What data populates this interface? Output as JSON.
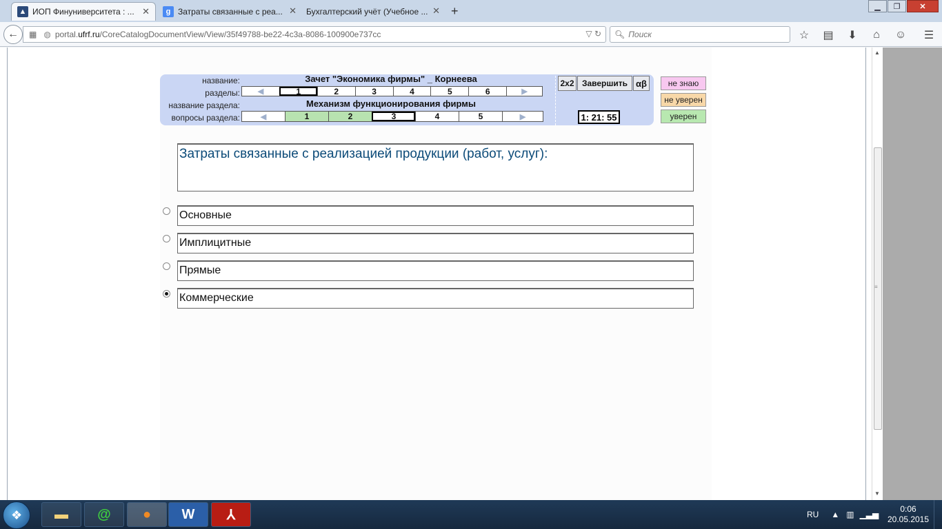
{
  "browser": {
    "tabs": [
      {
        "label": "ИОП Финуниверситета : ...",
        "active": true,
        "favicon": "graduation-cap-icon"
      },
      {
        "label": "Затраты связанные с реа...",
        "active": false,
        "favicon": "google-g-icon"
      },
      {
        "label": "Бухгалтерский учёт (Учебное ...",
        "active": false,
        "favicon": "none"
      }
    ],
    "url_host": "portal.ufrf.ru",
    "url_path": "/CoreCatalogDocumentView/View/35f49788-be22-4c3a-8086-100900e737cc",
    "url_prefix": "portal.",
    "url_domain": "ufrf.ru",
    "search_placeholder": "Поиск"
  },
  "test": {
    "labels": {
      "name": "название:",
      "sections": "разделы:",
      "section_name": "название раздела:",
      "section_questions": "вопросы раздела:"
    },
    "title": "Зачет \"Экономика фирмы\" _ Корнеева",
    "section_title": "Механизм функционирования  фирмы",
    "sections": [
      "1",
      "2",
      "3",
      "4",
      "5",
      "6"
    ],
    "current_section": "1",
    "questions": [
      "1",
      "2",
      "3",
      "4",
      "5"
    ],
    "answered_questions": [
      "1",
      "2"
    ],
    "current_question": "3",
    "buttons": {
      "grid": "2x2",
      "finish": "Завершить",
      "alpha_beta": "αβ"
    },
    "timer": "1: 21: 55",
    "confidence": [
      {
        "label": "не знаю",
        "color": "#f8c8f0"
      },
      {
        "label": "не уверен",
        "color": "#f8d8a8"
      },
      {
        "label": "уверен",
        "color": "#b8e8b0"
      }
    ]
  },
  "question": {
    "text": "Затраты связанные с реализацией продукции (работ, услуг):",
    "options": [
      {
        "label": "Основные",
        "selected": false
      },
      {
        "label": "Имплицитные",
        "selected": false
      },
      {
        "label": "Прямые",
        "selected": false
      },
      {
        "label": "Коммерческие",
        "selected": true
      }
    ]
  },
  "taskbar": {
    "apps": [
      "explorer-icon",
      "mail-ru-agent-icon",
      "firefox-icon",
      "word-icon",
      "acrobat-icon"
    ],
    "language": "RU",
    "time": "0:06",
    "date": "20.05.2015"
  }
}
